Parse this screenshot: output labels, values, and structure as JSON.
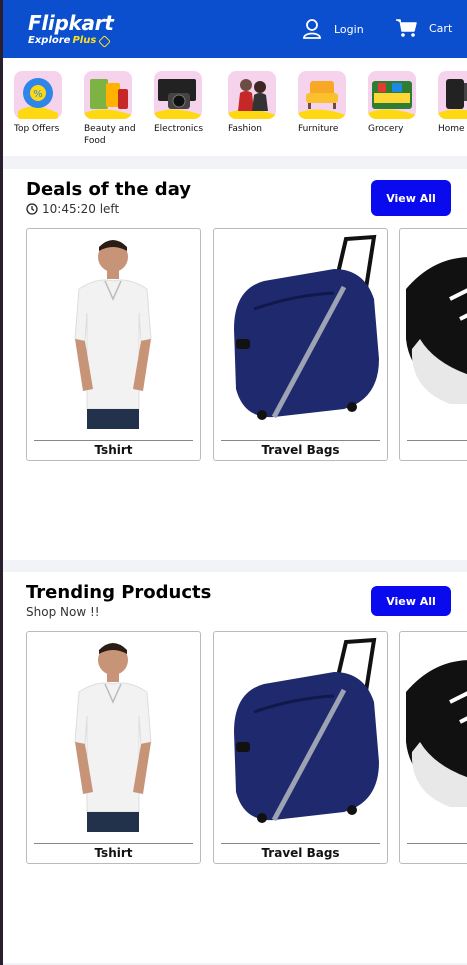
{
  "header": {
    "logo_main": "Flipkart",
    "logo_sub": "Explore",
    "logo_plus": "Plus",
    "login_label": "Login",
    "cart_label": "Cart",
    "brand_color": "#0b4fcf",
    "accent_color": "#ffe11b"
  },
  "categories": [
    {
      "label": "Top Offers",
      "icon": "offer-icon"
    },
    {
      "label": "Beauty and Food",
      "icon": "beauty-food-icon"
    },
    {
      "label": "Electronics",
      "icon": "electronics-icon"
    },
    {
      "label": "Fashion",
      "icon": "fashion-icon"
    },
    {
      "label": "Furniture",
      "icon": "furniture-icon"
    },
    {
      "label": "Grocery",
      "icon": "grocery-icon"
    },
    {
      "label": "Home Kitchen",
      "icon": "home-kitchen-icon"
    }
  ],
  "deals": {
    "title": "Deals of the day",
    "subtitle": "10:45:20 left",
    "view_all": "View All",
    "products": [
      {
        "label": "Tshirt",
        "icon": "tshirt-product-image"
      },
      {
        "label": "Travel Bags",
        "icon": "travel-bag-product-image"
      },
      {
        "label": "",
        "icon": "shoe-product-image"
      }
    ]
  },
  "trending": {
    "title": "Trending Products",
    "subtitle": "Shop Now !!",
    "view_all": "View All",
    "products": [
      {
        "label": "Tshirt",
        "icon": "tshirt-product-image"
      },
      {
        "label": "Travel Bags",
        "icon": "travel-bag-product-image"
      },
      {
        "label": "",
        "icon": "shoe-product-image"
      }
    ]
  },
  "colors": {
    "button": "#0a0aee",
    "page_bg": "#f1f3f6"
  }
}
